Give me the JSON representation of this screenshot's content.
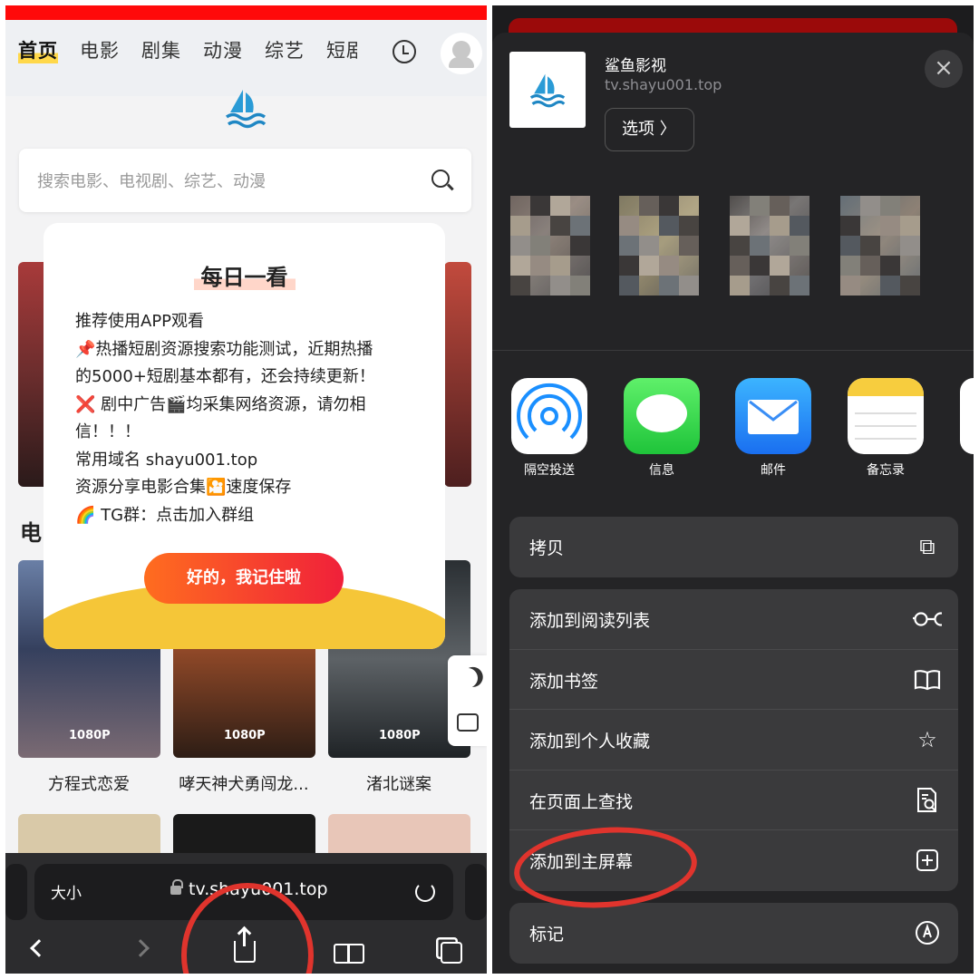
{
  "left": {
    "nav": [
      "首页",
      "电影",
      "剧集",
      "动漫",
      "综艺",
      "短剧"
    ],
    "search_placeholder": "搜索电影、电视剧、综艺、动漫",
    "section_partial": "电",
    "modal": {
      "title": "每日一看",
      "lines": [
        "推荐使用APP观看",
        "📌热播短剧资源搜索功能测试，近期热播",
        "的5000+短剧基本都有，还会持续更新！",
        "❌ 剧中广告🎬均采集网络资源，请勿相",
        "信！！！",
        "常用域名 shayu001.top",
        "资源分享电影合集🎦速度保存",
        "🌈 TG群：点击加入群组"
      ],
      "ok_label": "好的，我记住啦"
    },
    "movies": [
      {
        "title": "方程式恋爱",
        "badge": "1080P"
      },
      {
        "title": "哮天神犬勇闯龙...",
        "badge": "1080P"
      },
      {
        "title": "渚北谜案",
        "badge": "1080P"
      }
    ],
    "address": {
      "size_label": "大小",
      "url": "tv.shayu001.top"
    }
  },
  "right": {
    "app_name": "鲨鱼影视",
    "app_url": "tv.shayu001.top",
    "options_label": "选项 〉",
    "apps": [
      {
        "label": "隔空投送"
      },
      {
        "label": "信息"
      },
      {
        "label": "邮件"
      },
      {
        "label": "备忘录"
      }
    ],
    "actions_1": [
      {
        "label": "拷贝",
        "icon": "copy-icon"
      }
    ],
    "actions_2": [
      {
        "label": "添加到阅读列表",
        "icon": "glasses-icon"
      },
      {
        "label": "添加书签",
        "icon": "book-icon"
      },
      {
        "label": "添加到个人收藏",
        "icon": "star-icon"
      },
      {
        "label": "在页面上查找",
        "icon": "find-in-page-icon"
      },
      {
        "label": "添加到主屏幕",
        "icon": "add-square-icon"
      }
    ],
    "actions_3": [
      {
        "label": "标记",
        "icon": "markup-icon"
      }
    ]
  },
  "colors": {
    "annotation_circle": "#e0342d",
    "brand_red": "#ff0a0a",
    "ok_button": "#f0203a"
  }
}
